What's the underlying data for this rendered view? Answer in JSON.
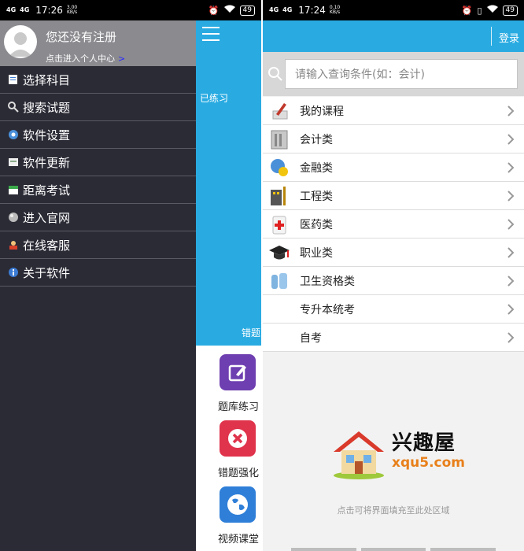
{
  "left_phone": {
    "status": {
      "network": "4G",
      "network2": "4G",
      "time": "17:26",
      "speed_value": "3.00",
      "speed_unit": "KB/s",
      "battery": "49"
    },
    "app": {
      "practiced_label": "已练习",
      "wrong_label": "错题",
      "tiles": [
        {
          "label": "题库练习"
        },
        {
          "label": "错题强化"
        },
        {
          "label": "视频课堂"
        }
      ]
    },
    "drawer": {
      "profile_name": "您还没有注册",
      "profile_sub": "点击进入个人中心",
      "profile_arrow": ">",
      "items": [
        {
          "label": "选择科目",
          "icon": "document-icon"
        },
        {
          "label": "搜索试题",
          "icon": "search-icon"
        },
        {
          "label": "软件设置",
          "icon": "gear-icon"
        },
        {
          "label": "软件更新",
          "icon": "update-icon"
        },
        {
          "label": "距离考试",
          "icon": "calendar-icon"
        },
        {
          "label": "进入官网",
          "icon": "globe-icon"
        },
        {
          "label": "在线客服",
          "icon": "support-icon"
        },
        {
          "label": "关于软件",
          "icon": "info-icon"
        }
      ]
    }
  },
  "right_phone": {
    "status": {
      "network": "4G",
      "network2": "4G",
      "time": "17:24",
      "speed_value": "0.10",
      "speed_unit": "KB/s",
      "battery": "49"
    },
    "login_label": "登录",
    "search_placeholder": "请输入查询条件(如：会计)",
    "categories": [
      {
        "label": "我的课程",
        "icon": "pencil-icon"
      },
      {
        "label": "会计类",
        "icon": "ledger-icon"
      },
      {
        "label": "金融类",
        "icon": "finance-icon"
      },
      {
        "label": "工程类",
        "icon": "building-icon"
      },
      {
        "label": "医药类",
        "icon": "medicine-icon"
      },
      {
        "label": "职业类",
        "icon": "graduation-cap-icon"
      },
      {
        "label": "卫生资格类",
        "icon": "health-icon"
      },
      {
        "label": "专升本统考",
        "icon": ""
      },
      {
        "label": "自考",
        "icon": ""
      }
    ],
    "watermark": {
      "name": "兴趣屋",
      "domain": "xqu5.com"
    },
    "footer_hint": "点击可将界面填充至此处区域"
  },
  "colors": {
    "accent": "#29abe2",
    "drawer_bg": "#2b2b36",
    "profile_bg": "#8a8a8f"
  }
}
